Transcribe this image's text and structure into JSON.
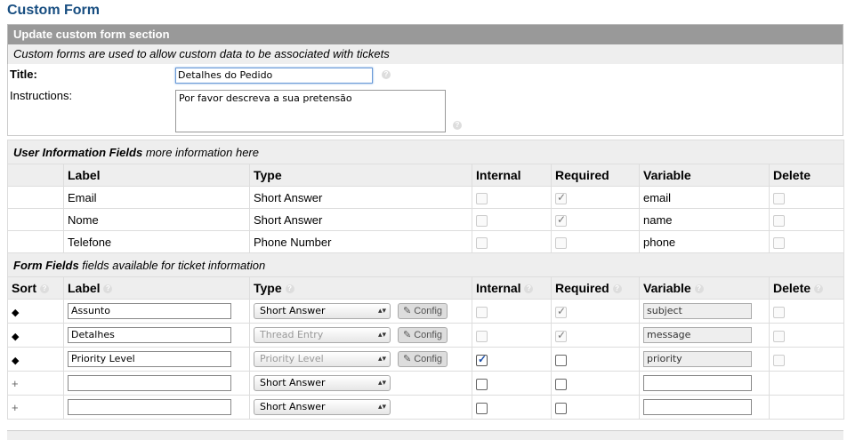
{
  "page_title": "Custom Form",
  "section": {
    "header": "Update custom form section",
    "description": "Custom forms are used to allow custom data to be associated with tickets"
  },
  "title_field": {
    "label": "Title:",
    "value": "Detalhes do Pedido",
    "help_icon": "question-icon"
  },
  "instructions_field": {
    "label": "Instructions:",
    "value": "Por favor descreva a sua pretensão",
    "help_icon": "question-icon"
  },
  "user_info": {
    "heading_bold": "User Information Fields",
    "heading_rest": " more information here",
    "columns": [
      "Label",
      "Type",
      "Internal",
      "Required",
      "Variable",
      "Delete"
    ],
    "rows": [
      {
        "label": "Email",
        "type": "Short Answer",
        "internal": false,
        "required": true,
        "variable": "email",
        "delete": false
      },
      {
        "label": "Nome",
        "type": "Short Answer",
        "internal": false,
        "required": true,
        "variable": "name",
        "delete": false
      },
      {
        "label": "Telefone",
        "type": "Phone Number",
        "internal": false,
        "required": false,
        "variable": "phone",
        "delete": false
      }
    ]
  },
  "form_fields": {
    "heading_bold": "Form Fields",
    "heading_rest": " fields available for ticket information",
    "columns": [
      "Sort",
      "Label",
      "Type",
      "Internal",
      "Required",
      "Variable",
      "Delete"
    ],
    "config_label": "Config",
    "rows": [
      {
        "label": "Assunto",
        "type": "Short Answer",
        "internal": false,
        "required": true,
        "variable": "subject"
      },
      {
        "label": "Detalhes",
        "type": "Thread Entry",
        "internal": false,
        "required": true,
        "variable": "message"
      },
      {
        "label": "Priority Level",
        "type": "Priority Level",
        "internal": true,
        "required": false,
        "variable": "priority"
      }
    ],
    "new_rows": [
      {
        "type": "Short Answer"
      },
      {
        "type": "Short Answer"
      }
    ]
  },
  "colors": {
    "title": "#184e81",
    "section_header_bg": "#999999",
    "subheader_bg": "#eeeeee"
  }
}
